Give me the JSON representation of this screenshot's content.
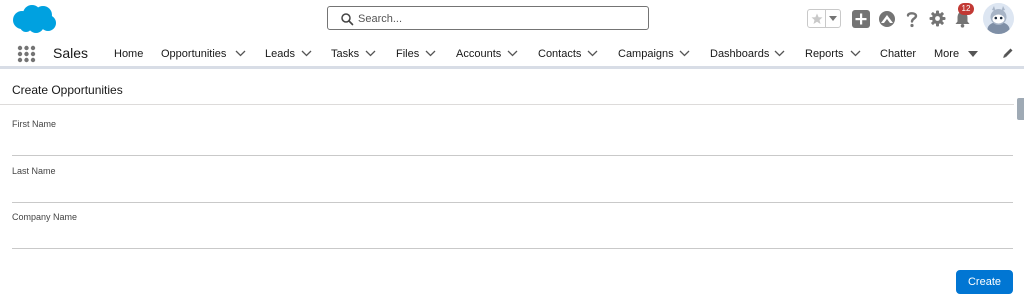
{
  "header": {
    "search": {
      "placeholder": "Search...",
      "value": ""
    },
    "notifications": {
      "count": "12"
    },
    "colors": {
      "brand": "#00a1e0",
      "badge": "#c23934",
      "icon": "#747474"
    }
  },
  "nav": {
    "app_name": "Sales",
    "items": [
      {
        "label": "Home"
      },
      {
        "label": "Opportunities"
      },
      {
        "label": "Leads"
      },
      {
        "label": "Tasks"
      },
      {
        "label": "Files"
      },
      {
        "label": "Accounts"
      },
      {
        "label": "Contacts"
      },
      {
        "label": "Campaigns"
      },
      {
        "label": "Dashboards"
      },
      {
        "label": "Reports"
      },
      {
        "label": "Chatter"
      },
      {
        "label": "More"
      }
    ]
  },
  "form": {
    "title": "Create Opportunities",
    "fields": [
      {
        "label": "First Name",
        "value": ""
      },
      {
        "label": "Last Name",
        "value": ""
      },
      {
        "label": "Company Name",
        "value": ""
      }
    ],
    "submit_label": "Create",
    "accent": "#0176d3"
  },
  "icons": [
    "salesforce-logo",
    "search-icon",
    "star-icon",
    "chevron-down-icon",
    "add-icon",
    "trailhead-icon",
    "help-icon",
    "gear-icon",
    "bell-icon",
    "avatar",
    "app-launcher-icon",
    "pencil-icon"
  ]
}
